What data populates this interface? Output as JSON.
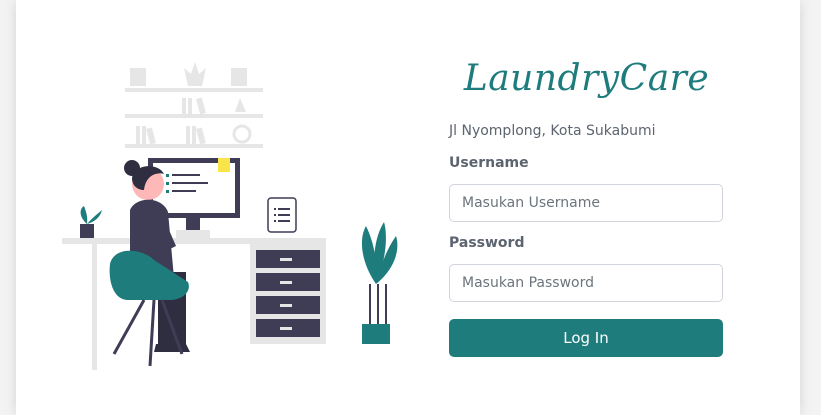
{
  "brand": {
    "name": "LaundryCare"
  },
  "address": "Jl Nyomplong, Kota Sukabumi",
  "form": {
    "username_label": "Username",
    "username_placeholder": "Masukan Username",
    "password_label": "Password",
    "password_placeholder": "Masukan Password",
    "login_label": "Log In"
  },
  "colors": {
    "accent": "#1f7c7c",
    "text_muted": "#5c6470"
  }
}
